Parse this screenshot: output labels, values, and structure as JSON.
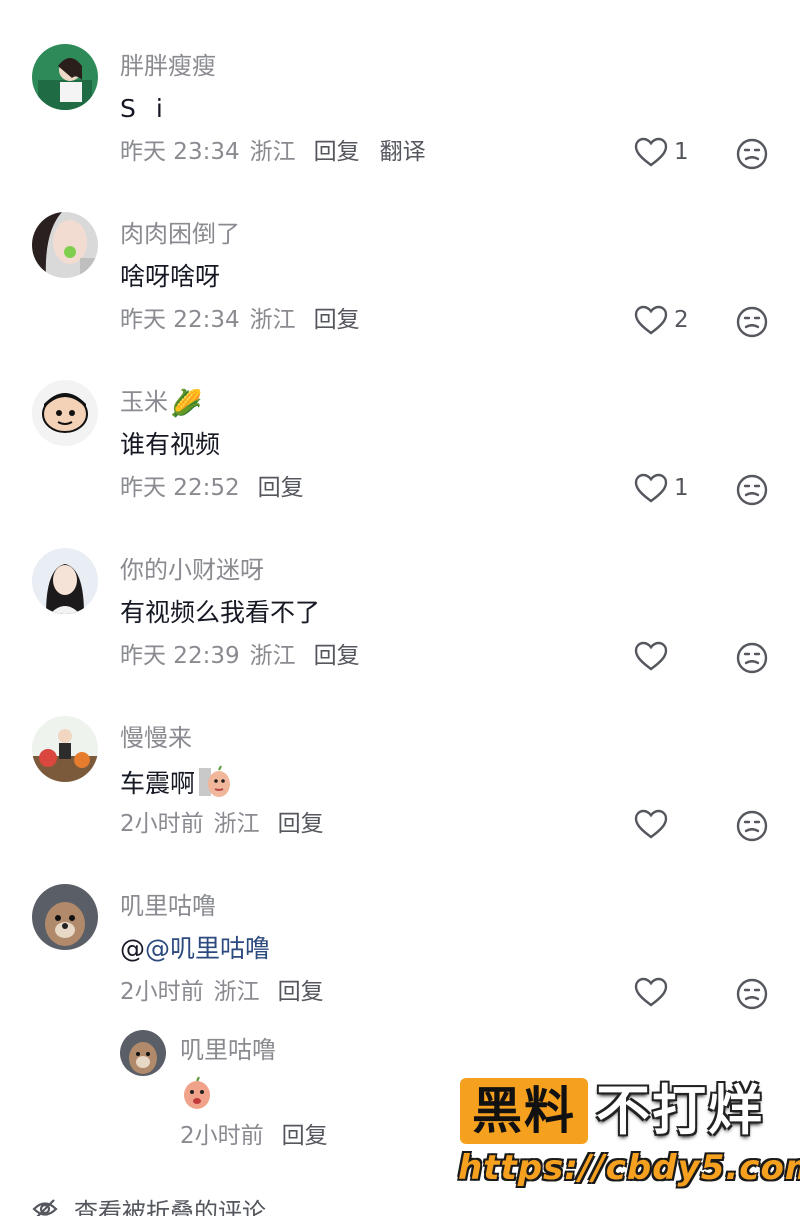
{
  "comments": [
    {
      "username": "胖胖瘦瘦",
      "text": "S i",
      "time": "昨天 23:34",
      "location": "浙江",
      "reply_label": "回复",
      "translate_label": "翻译",
      "likes": "1"
    },
    {
      "username": "肉肉困倒了",
      "text": "啥呀啥呀",
      "time": "昨天 22:34",
      "location": "浙江",
      "reply_label": "回复",
      "likes": "2"
    },
    {
      "username": "玉米",
      "username_emoji": "🌽",
      "text": "谁有视频",
      "time": "昨天 22:52",
      "reply_label": "回复",
      "likes": "1"
    },
    {
      "username": "你的小财迷呀",
      "text": "有视频么我看不了",
      "time": "昨天 22:39",
      "location": "浙江",
      "reply_label": "回复",
      "likes": ""
    },
    {
      "username": "慢慢来",
      "text": "车震啊",
      "time": "2小时前",
      "location": "浙江",
      "reply_label": "回复",
      "likes": ""
    },
    {
      "username": "叽里咕噜",
      "text_prefix": "@",
      "mention": "@叽里咕噜",
      "time": "2小时前",
      "location": "浙江",
      "reply_label": "回复",
      "likes": ""
    }
  ],
  "reply": {
    "username": "叽里咕噜",
    "time": "2小时前",
    "reply_label": "回复"
  },
  "folded_label": "查看被折叠的评论",
  "watermark": {
    "badge": "黑料",
    "rest": "不打烊",
    "url": "https://cbdy5.com"
  },
  "colors": {
    "secondary_text": "#8a8b91",
    "action_text": "#55575e",
    "mention": "#2c4a7e",
    "watermark_orange": "#f5a01f"
  },
  "icons": [
    "heart-outline-icon",
    "dislike-face-icon",
    "eye-slash-icon"
  ]
}
